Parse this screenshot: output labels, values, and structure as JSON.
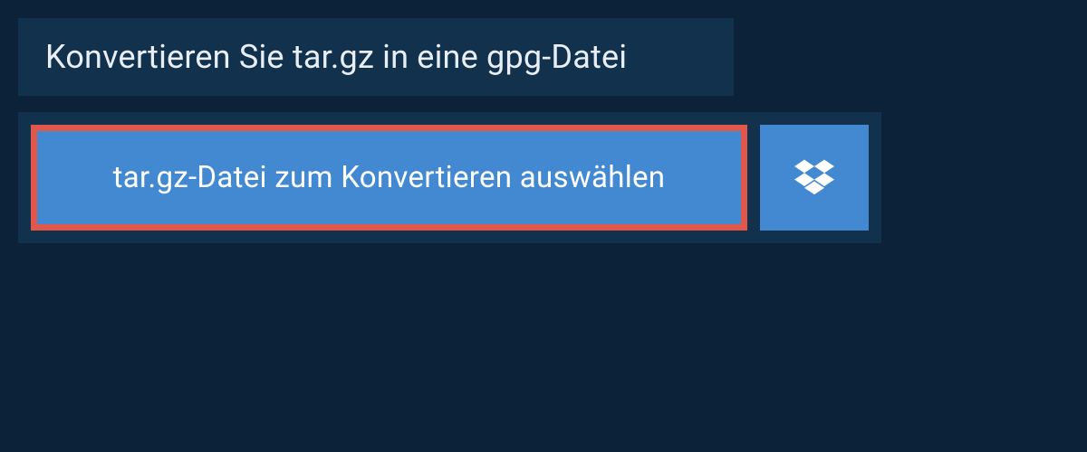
{
  "header": {
    "title": "Konvertieren Sie tar.gz in eine gpg-Datei"
  },
  "upload": {
    "select_label": "tar.gz-Datei zum Konvertieren auswählen",
    "dropbox_icon_name": "dropbox-icon"
  },
  "colors": {
    "page_bg": "#0c2238",
    "panel_bg": "#11314d",
    "button_bg": "#4289d2",
    "highlight_border": "#e1574b",
    "text_light": "#e8eef4",
    "text_white": "#ffffff"
  }
}
